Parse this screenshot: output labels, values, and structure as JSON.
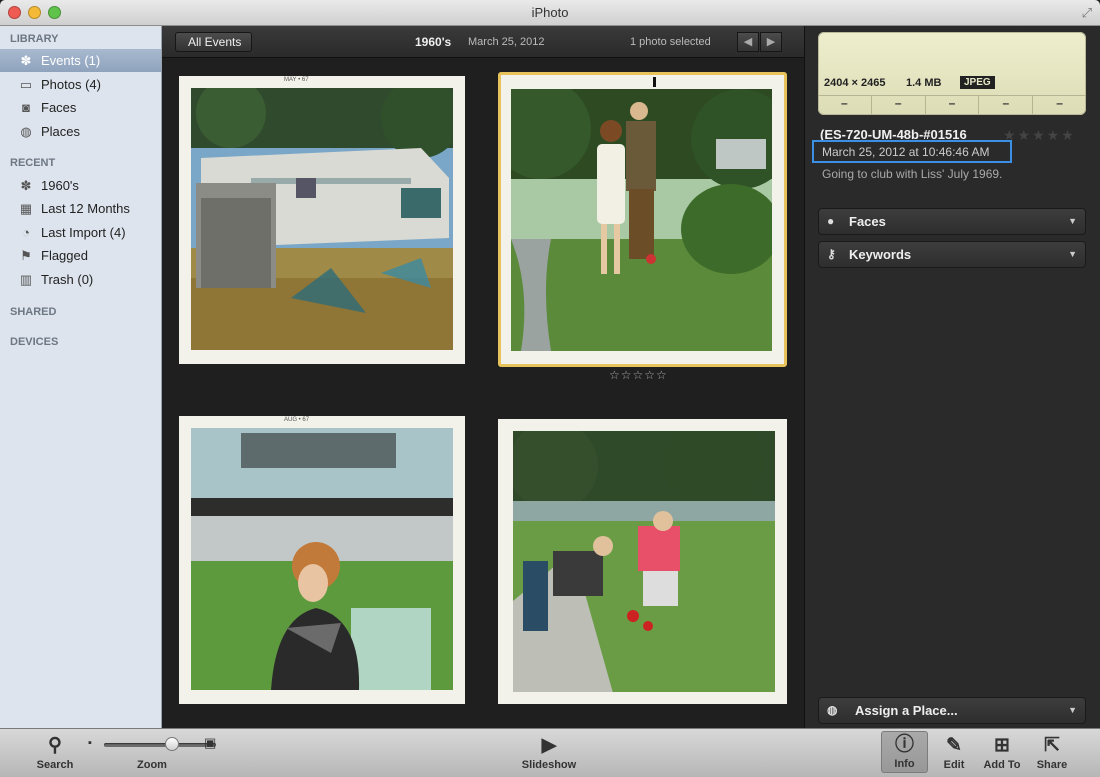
{
  "window": {
    "title": "iPhoto"
  },
  "sidebar": {
    "sections": {
      "library": "LIBRARY",
      "recent": "RECENT",
      "shared": "SHARED",
      "devices": "DEVICES"
    },
    "library_items": [
      {
        "label": "Events (1)",
        "icon": "palm-tree-icon",
        "selected": true
      },
      {
        "label": "Photos (4)",
        "icon": "photos-icon"
      },
      {
        "label": "Faces",
        "icon": "faces-icon"
      },
      {
        "label": "Places",
        "icon": "globe-icon"
      }
    ],
    "recent_items": [
      {
        "label": "1960's",
        "icon": "palm-tree-icon"
      },
      {
        "label": "Last 12 Months",
        "icon": "calendar-icon"
      },
      {
        "label": "Last Import (4)",
        "icon": "import-icon"
      },
      {
        "label": "Flagged",
        "icon": "flag-icon"
      },
      {
        "label": "Trash (0)",
        "icon": "trash-icon"
      }
    ]
  },
  "header": {
    "back_label": "All Events",
    "event_name": "1960's",
    "event_date": "March 25, 2012",
    "selection": "1 photo selected"
  },
  "photos": [
    {
      "stamp": "MAY • 67",
      "selected": false
    },
    {
      "stamp": "",
      "selected": true,
      "rating_display": "☆☆☆☆☆"
    },
    {
      "stamp": "AUG • 67",
      "selected": false
    },
    {
      "stamp": "",
      "selected": false
    }
  ],
  "info": {
    "dimensions": "2404 × 2465",
    "file_size": "1.4 MB",
    "file_type": "JPEG",
    "exif_dashes": [
      "–",
      "–",
      "–",
      "–",
      "–"
    ],
    "filename": "(ES-720-UM-48b-#01516",
    "rating_display": "★★★★★",
    "date": "March 25, 2012 at 10:46:46 AM",
    "description": "Going to club with Liss' July 1969.",
    "faces_label": "Faces",
    "keywords_label": "Keywords",
    "place_label": "Assign a Place...",
    "highlight_color": "#3b8fe6"
  },
  "toolbar": {
    "search": "Search",
    "zoom": "Zoom",
    "zoom_level": 0.62,
    "slideshow": "Slideshow",
    "info": "Info",
    "edit": "Edit",
    "add_to": "Add To",
    "share": "Share"
  }
}
